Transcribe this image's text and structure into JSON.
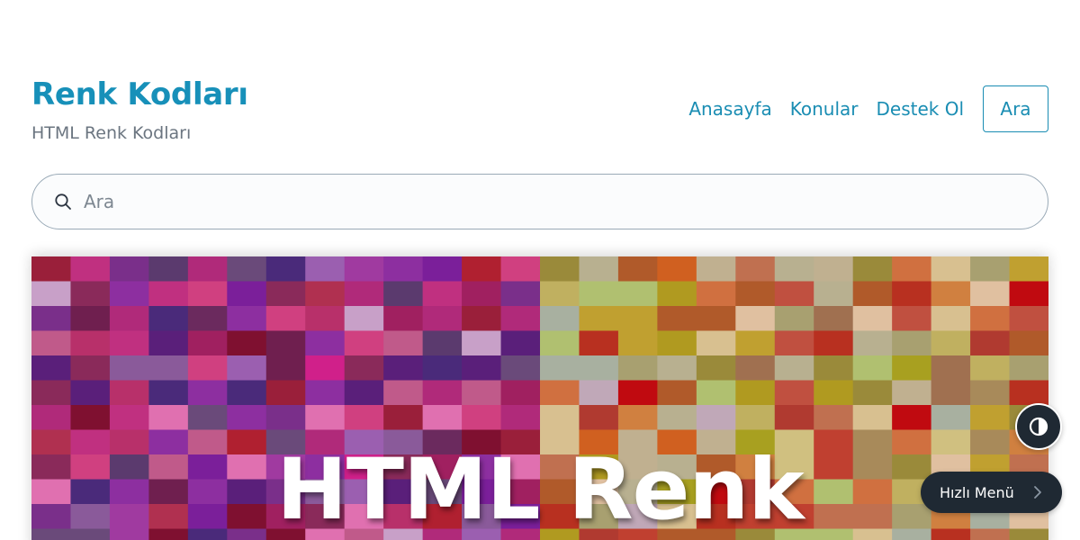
{
  "site": {
    "title": "Renk Kodları",
    "subtitle": "HTML Renk Kodları"
  },
  "nav": {
    "links": [
      "Anasayfa",
      "Konular",
      "Destek Ol"
    ],
    "search_button": "Ara"
  },
  "search": {
    "placeholder": "Ara",
    "icon": "search-icon"
  },
  "hero": {
    "title": "HTML Renk",
    "palette_left": [
      "#5a1f7a",
      "#6b2a5e",
      "#4a2a7a",
      "#7a2f8a",
      "#8a2a5a",
      "#6f1f4f",
      "#5b3a6e",
      "#7b1f9a",
      "#a02060",
      "#7f1030",
      "#8d2fa0",
      "#b02a7a",
      "#9a1f3a",
      "#6a4a7a",
      "#c03080",
      "#a03aa0",
      "#b8306a",
      "#d04080",
      "#8a5a9a",
      "#c05a8a",
      "#b02030",
      "#d0208a",
      "#9b5fb0",
      "#e070b0",
      "#c8a0c8",
      "#b03050"
    ],
    "palette_right": [
      "#a88a5a",
      "#9a8a3a",
      "#b09a20",
      "#a8a070",
      "#c0b090",
      "#a8a020",
      "#b05a2a",
      "#a07050",
      "#c04030",
      "#b0c070",
      "#d08040",
      "#c0a030",
      "#b8b090",
      "#d0c080",
      "#c07050",
      "#b83020",
      "#c00a10",
      "#d06020",
      "#c0a8b8",
      "#e0c0a0",
      "#c0b060",
      "#a8b0a0",
      "#c05040",
      "#b03a30",
      "#d07040",
      "#d8c090"
    ]
  },
  "floating": {
    "theme_toggle_icon": "contrast-icon",
    "quick_menu_label": "Hızlı Menü",
    "quick_menu_icon": "chevron-right-icon"
  },
  "colors": {
    "brand": "#1790b9",
    "link": "#1a8db3",
    "muted": "#6b7580",
    "dark_button": "#1f2933"
  }
}
